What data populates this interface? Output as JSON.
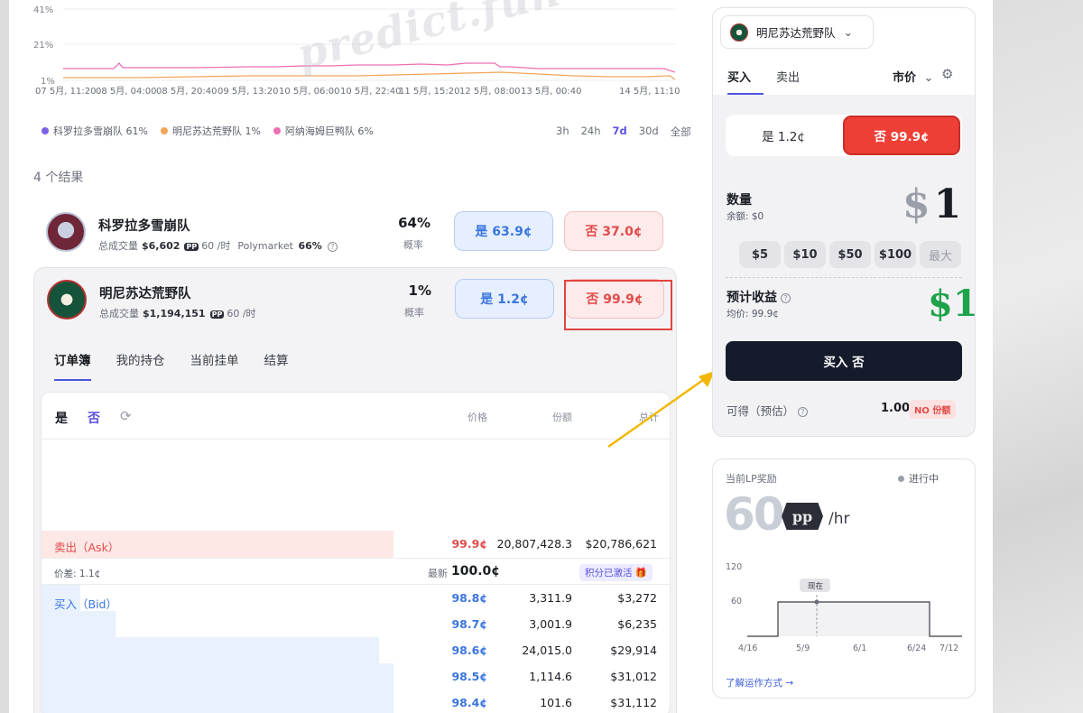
{
  "watermark": "predict.fun",
  "chart": {
    "y_ticks": [
      "41%",
      "21%",
      "1%"
    ],
    "x_ticks": [
      "07 5月, 11:20",
      "08 5月, 04:00",
      "08 5月, 20:40",
      "09 5月, 13:20",
      "10 5月, 06:00",
      "10 5月, 22:40",
      "11 5月, 15:20",
      "12 5月, 08:00",
      "13 5月, 00:40",
      "14 5月, 11:10"
    ],
    "legend": [
      {
        "label": "科罗拉多雪崩队 61%",
        "color": "#7b61e8"
      },
      {
        "label": "明尼苏达荒野队 1%",
        "color": "#f2a65a"
      },
      {
        "label": "阿纳海姆巨鸭队 6%",
        "color": "#ee6fb4"
      }
    ],
    "ranges": [
      "3h",
      "24h",
      "7d",
      "30d",
      "全部"
    ],
    "active_range": "7d"
  },
  "results_count": "4 个结果",
  "markets": [
    {
      "name": "科罗拉多雪崩队",
      "volume_label": "总成交量",
      "volume": "$6,602",
      "pp_icon": "PP",
      "pp_rate": "60 /时",
      "polymarket_label": "Polymarket",
      "polymarket_value": "66%",
      "prob": "64%",
      "prob_label": "概率",
      "yes": "是 63.9¢",
      "no": "否 37.0¢"
    },
    {
      "name": "明尼苏达荒野队",
      "volume_label": "总成交量",
      "volume": "$1,194,151",
      "pp_icon": "PP",
      "pp_rate": "60 /时",
      "prob": "1%",
      "prob_label": "概率",
      "yes": "是 1.2¢",
      "no": "否 99.9¢"
    }
  ],
  "tabs": [
    "订单簿",
    "我的持仓",
    "当前挂单",
    "结算"
  ],
  "orderbook": {
    "toggle_yes": "是",
    "toggle_no": "否",
    "col_price": "价格",
    "col_shares": "份额",
    "col_total": "总计",
    "ask_label": "卖出（Ask）",
    "ask": {
      "price": "99.9¢",
      "shares": "20,807,428.3",
      "total": "$20,786,621"
    },
    "spread": "价差: 1.1¢",
    "latest_label": "最新",
    "latest_value": "100.0¢",
    "points_badge": "积分已激活 🎁",
    "bid_label": "买入（Bid）",
    "bids": [
      {
        "price": "98.8¢",
        "shares": "3,311.9",
        "total": "$3,272",
        "depth": 0.11
      },
      {
        "price": "98.7¢",
        "shares": "3,001.9",
        "total": "$6,235",
        "depth": 0.21
      },
      {
        "price": "98.6¢",
        "shares": "24,015.0",
        "total": "$29,914",
        "depth": 0.96
      },
      {
        "price": "98.5¢",
        "shares": "1,114.6",
        "total": "$31,012",
        "depth": 1.0
      },
      {
        "price": "98.4¢",
        "shares": "101.6",
        "total": "$31,112",
        "depth": 1.0
      }
    ]
  },
  "trade_panel": {
    "selected_team": "明尼苏达荒野队",
    "tab_buy": "买入",
    "tab_sell": "卖出",
    "order_type": "市价",
    "yes_option": "是  1.2¢",
    "no_option": "否  99.9¢",
    "qty_label": "数量",
    "balance": "余额: $0",
    "amount_currency": "$",
    "amount_value": "1",
    "quick_amounts": [
      "$5",
      "$10",
      "$50",
      "$100",
      "最大"
    ],
    "profit_label": "预计收益",
    "avg_price": "均价:  99.9¢",
    "profit_value": "$1",
    "buy_button": "买入 否",
    "estimate_label": "可得（预估）",
    "estimate_value": "1.00",
    "estimate_badge": "NO 份额"
  },
  "lp_card": {
    "title": "当前LP奖励",
    "status": "进行中",
    "rate": "60",
    "pp": "pp",
    "unit": "/hr",
    "y_ticks": [
      "120",
      "60"
    ],
    "x_ticks": [
      "4/16",
      "5/9",
      "6/1",
      "6/24",
      "7/12"
    ],
    "now_label": "现在",
    "link": "了解运作方式 →"
  },
  "colors": {
    "accent": "#5b50e6",
    "yes_blue": "#3a76df",
    "no_red": "#e24a4a",
    "profit_green": "#1fa34a",
    "annotation_arrow": "#f2b705",
    "highlight_box": "#e2443e"
  }
}
